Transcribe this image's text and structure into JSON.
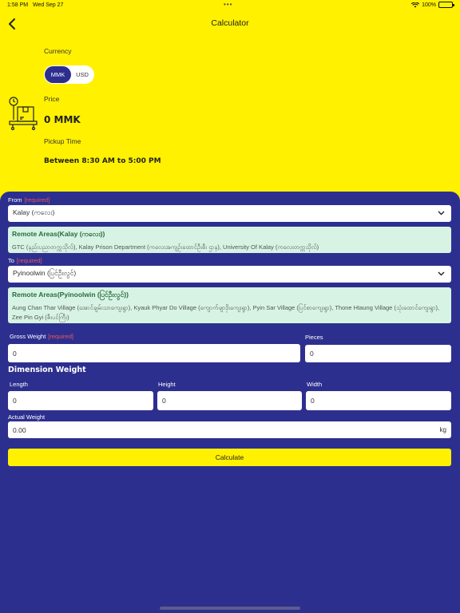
{
  "status": {
    "time": "1:58 PM",
    "date": "Wed Sep 27",
    "battery": "100%"
  },
  "header": {
    "title": "Calculator"
  },
  "currency": {
    "label": "Currency",
    "options": [
      "MMK",
      "USD"
    ],
    "selected": "MMK"
  },
  "price": {
    "label": "Price",
    "value": "0 MMK"
  },
  "pickup": {
    "label": "Pickup Time",
    "value": "Between 8:30 AM to 5:00 PM"
  },
  "form": {
    "required_tag": "[required]",
    "from": {
      "label": "From",
      "value": "Kalay (ကလေး)",
      "remote_title": "Remote Areas(Kalay (ကလေး))",
      "remote_text": "GTC (နည်းပညာတက္ကသိုလ်), Kalay Prison Department (ကလေးအကျဉ်းထောင်ဦးစီး ဌာန), University Of Kalay (ကလေးတက္ကသိုလ်)"
    },
    "to": {
      "label": "To",
      "value": "Pyinoolwin (ပြင်ဦးလွင်)",
      "remote_title": "Remote Areas(Pyinoolwin (ပြင်ဦးလွင်))",
      "remote_text": "Aung Chan Thar Village (အောင်ချမ်းသာကျေးရွာ), Kyauk Phyar Do Village (ကျောက်ဖျာဒိုးကျေးရွာ), Pyin Sar Village (ပြင်စာကျေးရွာ), Thone Htaung Village (သုံးထောင်ကျေးရွာ), Zee Pin Gyi (ဇီးပင်ကြီး)"
    },
    "gross_weight": {
      "label": "Gross Weight",
      "value": "0"
    },
    "pieces": {
      "label": "Pieces",
      "value": "0"
    },
    "dimension_heading": "Dimension Weight",
    "length": {
      "label": "Length",
      "value": "0"
    },
    "height": {
      "label": "Height",
      "value": "0"
    },
    "width": {
      "label": "Width",
      "value": "0"
    },
    "actual_weight": {
      "label": "Actual Weight",
      "value": "0.00",
      "unit": "kg"
    },
    "calculate_label": "Calculate"
  },
  "colors": {
    "yellow": "#fff100",
    "navy": "#2d2f8f",
    "remote_bg": "#d7f3e4",
    "required": "#e8585a"
  }
}
